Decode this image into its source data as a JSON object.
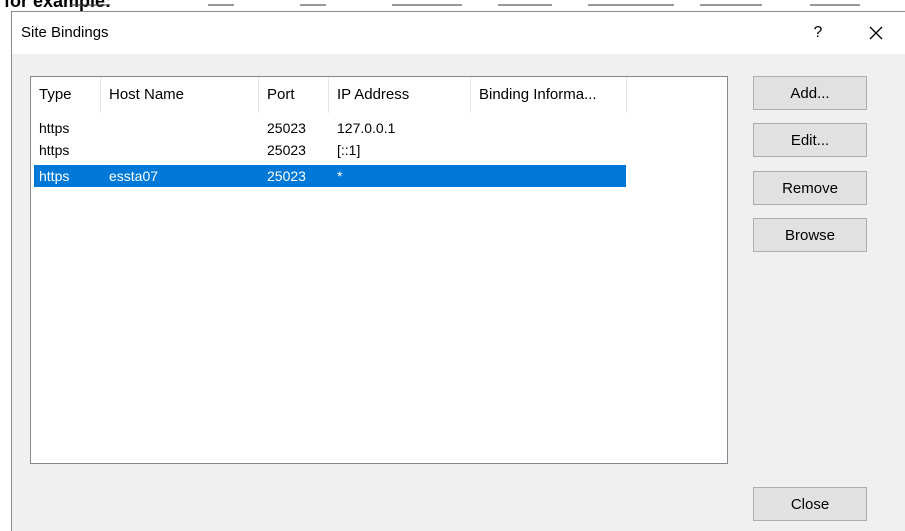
{
  "background": {
    "partial_text": "for example:"
  },
  "dialog": {
    "title": "Site Bindings",
    "help_label": "?",
    "icons": {
      "close": "close-icon"
    }
  },
  "bindings": {
    "columns": [
      "Type",
      "Host Name",
      "Port",
      "IP Address",
      "Binding Informa..."
    ],
    "rows": [
      {
        "type": "https",
        "host": "",
        "port": "25023",
        "ip": "127.0.0.1",
        "info": ""
      },
      {
        "type": "https",
        "host": "",
        "port": "25023",
        "ip": "[::1]",
        "info": ""
      },
      {
        "type": "https",
        "host": "essta07",
        "port": "25023",
        "ip": "*",
        "info": "",
        "selected": true
      }
    ]
  },
  "buttons": {
    "add": "Add...",
    "edit": "Edit...",
    "remove": "Remove",
    "browse": "Browse",
    "close": "Close"
  },
  "colors": {
    "selection": "#0078d7",
    "dialog_bg": "#f0f0f0",
    "list_bg": "#ffffff"
  }
}
